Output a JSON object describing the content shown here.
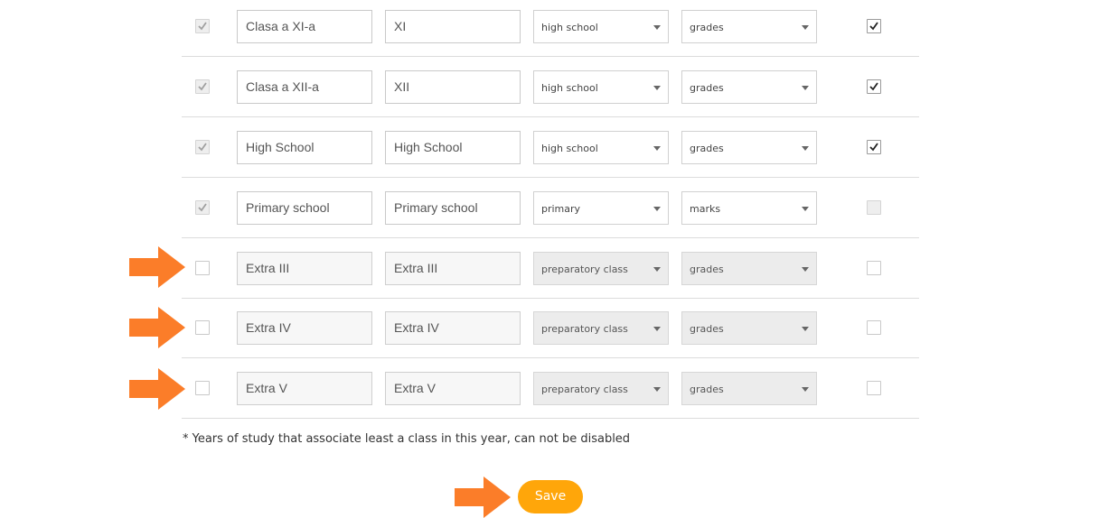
{
  "rows": [
    {
      "selected": true,
      "selectable": false,
      "name": "Clasa a XI-a",
      "short_name": "XI",
      "level": "high school",
      "grading": "grades",
      "active": true,
      "active_disabled": false,
      "editable": true
    },
    {
      "selected": true,
      "selectable": false,
      "name": "Clasa a XII-a",
      "short_name": "XII",
      "level": "high school",
      "grading": "grades",
      "active": true,
      "active_disabled": false,
      "editable": true
    },
    {
      "selected": true,
      "selectable": false,
      "name": "High School",
      "short_name": "High School",
      "level": "high school",
      "grading": "grades",
      "active": true,
      "active_disabled": false,
      "editable": true
    },
    {
      "selected": true,
      "selectable": false,
      "name": "Primary school",
      "short_name": "Primary school",
      "level": "primary",
      "grading": "marks",
      "active": false,
      "active_disabled": true,
      "editable": true
    },
    {
      "selected": false,
      "selectable": true,
      "name": "Extra III",
      "short_name": "Extra III",
      "level": "preparatory class",
      "grading": "grades",
      "active": false,
      "active_disabled": false,
      "editable": false
    },
    {
      "selected": false,
      "selectable": true,
      "name": "Extra IV",
      "short_name": "Extra IV",
      "level": "preparatory class",
      "grading": "grades",
      "active": false,
      "active_disabled": false,
      "editable": false
    },
    {
      "selected": false,
      "selectable": true,
      "name": "Extra V",
      "short_name": "Extra V",
      "level": "preparatory class",
      "grading": "grades",
      "active": false,
      "active_disabled": false,
      "editable": false
    }
  ],
  "footnote": "* Years of study that associate least a class in this year, can not be disabled",
  "save_label": "Save",
  "colors": {
    "accent": "#ffa60a",
    "arrow": "#fb7d29"
  }
}
